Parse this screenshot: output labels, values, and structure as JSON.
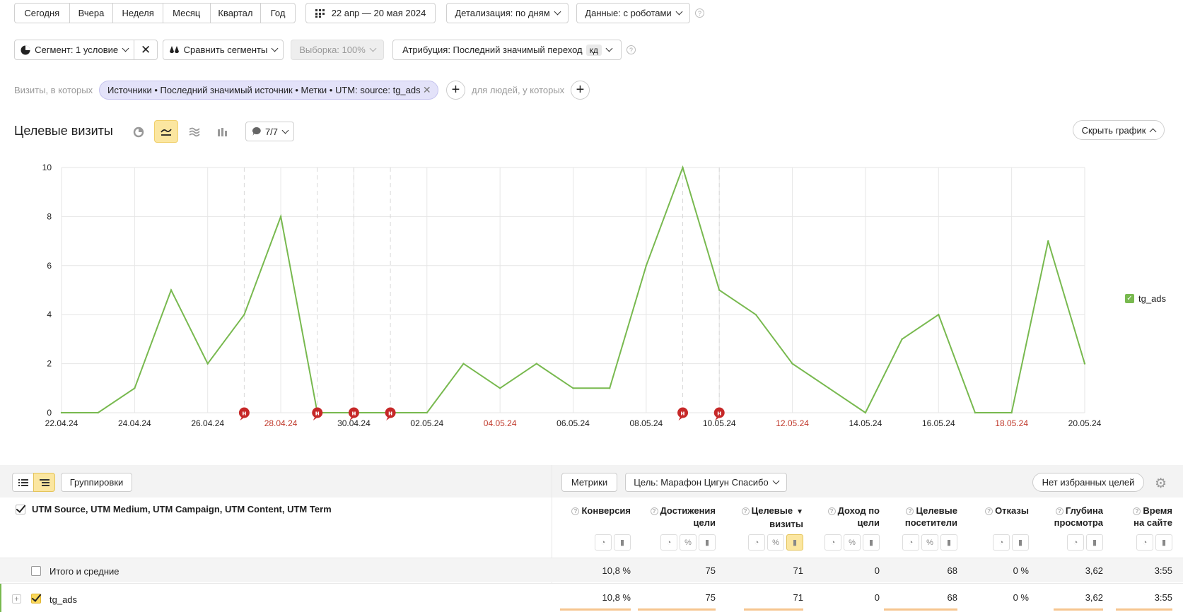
{
  "period_tabs": [
    "Сегодня",
    "Вчера",
    "Неделя",
    "Месяц",
    "Квартал",
    "Год"
  ],
  "date_range": "22 апр — 20 мая 2024",
  "detail_label": "Детализация: по дням",
  "data_label": "Данные: с роботами",
  "segment_label": "Сегмент: 1 условие",
  "compare_label": "Сравнить сегменты",
  "sample_label": "Выборка: 100%",
  "attribution_label": "Атрибуция: Последний значимый переход",
  "attribution_badge": "кд",
  "filter": {
    "prefix": "Визиты, в которых",
    "chip": "Источники • Последний значимый источник • Метки • UTM: source: tg_ads",
    "people": "для людей, у которых"
  },
  "chart_header": {
    "title": "Целевые визиты",
    "annotations": "7/7",
    "hide": "Скрыть график"
  },
  "chart_data": {
    "type": "line",
    "title": "",
    "xlabel": "",
    "ylabel": "",
    "ylim": [
      0,
      10
    ],
    "yticks": [
      0,
      2,
      4,
      6,
      8,
      10
    ],
    "x": [
      "22.04.24",
      "23.04.24",
      "24.04.24",
      "25.04.24",
      "26.04.24",
      "27.04.24",
      "28.04.24",
      "29.04.24",
      "30.04.24",
      "01.05.24",
      "02.05.24",
      "03.05.24",
      "04.05.24",
      "05.05.24",
      "06.05.24",
      "07.05.24",
      "08.05.24",
      "09.05.24",
      "10.05.24",
      "11.05.24",
      "12.05.24",
      "13.05.24",
      "14.05.24",
      "15.05.24",
      "16.05.24",
      "17.05.24",
      "18.05.24",
      "19.05.24",
      "20.05.24"
    ],
    "xtick_labels": [
      {
        "label": "22.04.24",
        "index": 0,
        "color": "#222222"
      },
      {
        "label": "24.04.24",
        "index": 2,
        "color": "#222222"
      },
      {
        "label": "26.04.24",
        "index": 4,
        "color": "#222222"
      },
      {
        "label": "28.04.24",
        "index": 6,
        "color": "#c0392b"
      },
      {
        "label": "30.04.24",
        "index": 8,
        "color": "#222222"
      },
      {
        "label": "02.05.24",
        "index": 10,
        "color": "#222222"
      },
      {
        "label": "04.05.24",
        "index": 12,
        "color": "#c0392b"
      },
      {
        "label": "06.05.24",
        "index": 14,
        "color": "#222222"
      },
      {
        "label": "08.05.24",
        "index": 16,
        "color": "#222222"
      },
      {
        "label": "10.05.24",
        "index": 18,
        "color": "#222222"
      },
      {
        "label": "12.05.24",
        "index": 20,
        "color": "#c0392b"
      },
      {
        "label": "14.05.24",
        "index": 22,
        "color": "#222222"
      },
      {
        "label": "16.05.24",
        "index": 24,
        "color": "#222222"
      },
      {
        "label": "18.05.24",
        "index": 26,
        "color": "#c0392b"
      },
      {
        "label": "20.05.24",
        "index": 28,
        "color": "#222222"
      }
    ],
    "series": [
      {
        "name": "tg_ads",
        "color": "#78b94f",
        "values": [
          0,
          0,
          1,
          5,
          2,
          4,
          8,
          0,
          0,
          0,
          0,
          2,
          1,
          2,
          1,
          1,
          6,
          10,
          5,
          4,
          2,
          1,
          0,
          3,
          4,
          0,
          0,
          7,
          2
        ]
      }
    ],
    "annotation_markers": [
      5,
      7,
      8,
      9,
      17,
      18
    ],
    "annotation_marker_text": "н",
    "grid": true,
    "legend": "right"
  },
  "table": {
    "groupings_label": "Группировки",
    "metrics_label": "Метрики",
    "goal_label": "Цель: Марафон Цигун Спасибо",
    "favorites_label": "Нет избранных целей",
    "dimension_header": "UTM Source, UTM Medium, UTM Campaign, UTM Content, UTM Term",
    "metric_headers": [
      [
        "Конверсия"
      ],
      [
        "Достижения",
        "цели"
      ],
      [
        "Целевые",
        "визиты"
      ],
      [
        "Доход по",
        "цели"
      ],
      [
        "Целевые",
        "посетители"
      ],
      [
        "Отказы"
      ],
      [
        "Глубина",
        "просмотра"
      ],
      [
        "Время",
        "на сайте"
      ]
    ],
    "sort_indicator": "▼",
    "rows": [
      {
        "label": "Итого и средние",
        "values": [
          "10,8 %",
          "75",
          "71",
          "0",
          "68",
          "0 %",
          "3,62",
          "3:55"
        ]
      },
      {
        "label": "tg_ads",
        "values": [
          "10,8 %",
          "75",
          "71",
          "0",
          "68",
          "0 %",
          "3,62",
          "3:55"
        ]
      }
    ]
  }
}
